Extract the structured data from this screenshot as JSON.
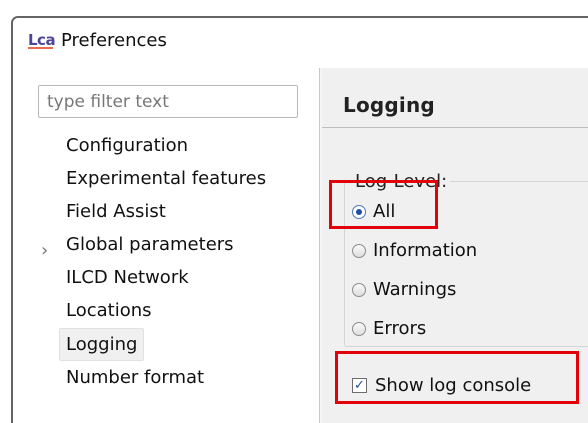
{
  "window": {
    "app_icon_text": "Lca",
    "title": "Preferences"
  },
  "navigation": {
    "filter_placeholder": "type filter text",
    "items": [
      {
        "label": "Configuration"
      },
      {
        "label": "Experimental features"
      },
      {
        "label": "Field Assist",
        "expandable": true,
        "expander": "›"
      },
      {
        "label": "Global parameters"
      },
      {
        "label": "ILCD Network"
      },
      {
        "label": "Locations"
      },
      {
        "label": "Logging",
        "selected": true
      },
      {
        "label": "Number format"
      }
    ]
  },
  "page": {
    "title": "Logging",
    "log_level": {
      "label": "Log-Level:",
      "options": [
        {
          "label": "All",
          "selected": true
        },
        {
          "label": "Information",
          "selected": false
        },
        {
          "label": "Warnings",
          "selected": false
        },
        {
          "label": "Errors",
          "selected": false
        }
      ]
    },
    "show_log_console": {
      "label": "Show log console",
      "checked": true,
      "checkmark": "✓"
    }
  },
  "annotations": {
    "highlight_color": "#e2000b"
  },
  "colors": {
    "window_border": "#636363",
    "page_background": "#f0f0f0",
    "selection_background": "#f0f0f0",
    "radio_checked": "#1d4fa5"
  }
}
